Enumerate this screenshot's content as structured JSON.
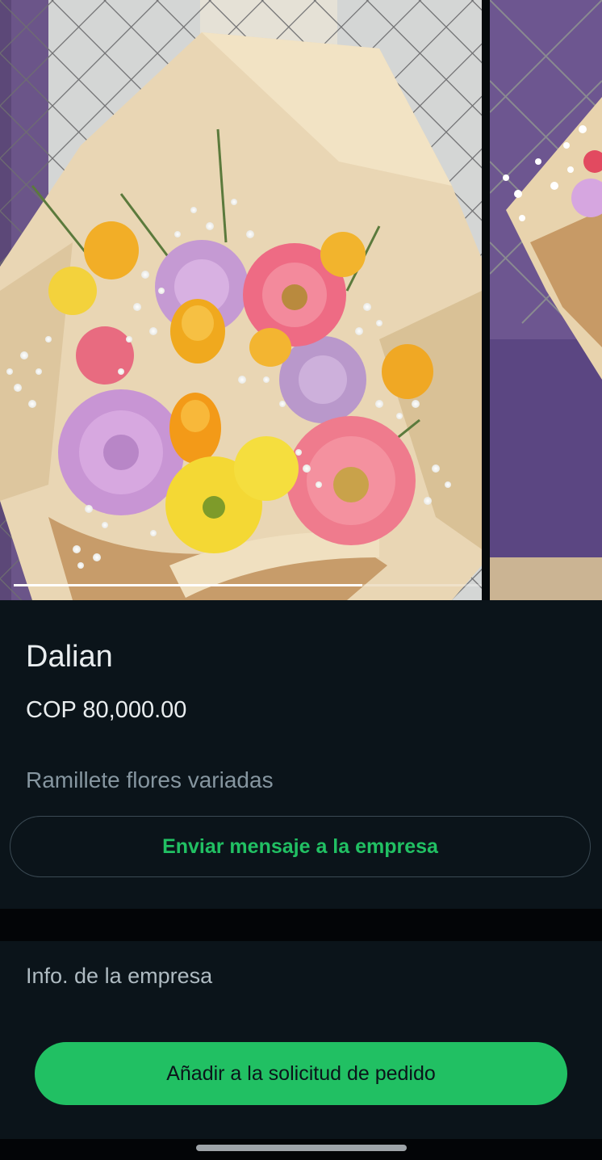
{
  "product": {
    "name": "Dalian",
    "price": "COP 80,000.00",
    "description": "Ramillete flores variadas"
  },
  "carousel": {
    "current_image": 1,
    "progress_fraction": 0.745
  },
  "actions": {
    "message_business": "Enviar mensaje a la empresa",
    "company_info": "Info. de la empresa",
    "add_to_order": "Añadir a la solicitud de pedido"
  },
  "colors": {
    "background": "#0b141a",
    "accent_green": "#21c063",
    "secondary_text": "#8696a0"
  }
}
